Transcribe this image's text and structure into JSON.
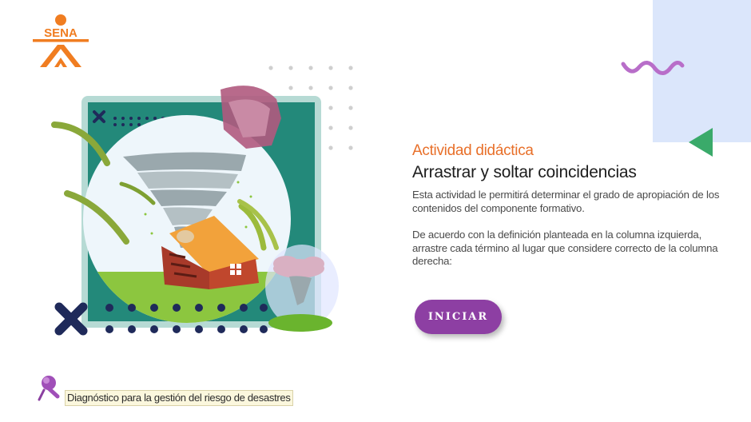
{
  "brand": {
    "logo_text": "SENA",
    "color": "#f07d21"
  },
  "content": {
    "subtitle": "Actividad didáctica",
    "title": "Arrastrar y soltar coincidencias",
    "paragraph1": "Esta actividad le permitirá determinar el grado de apropiación de los contenidos del componente formativo.",
    "paragraph2": "De acuerdo con la definición planteada en la columna izquierda, arrastre cada término al lugar que considere correcto de la columna derecha:"
  },
  "button": {
    "label": "INICIAR",
    "color": "#8d3fa3"
  },
  "footer": {
    "label": "Diagnóstico para la gestión del riesgo de desastres"
  },
  "colors": {
    "accent_orange": "#e8702a",
    "panel_blue": "#dbe6fb",
    "wave_purple": "#b86ec9",
    "triangle_green": "#3aaa6a",
    "navy": "#1f2a5a"
  },
  "icons": [
    "sena-logo",
    "tornado-illustration",
    "purple-wave-icon",
    "green-triangle-icon",
    "pushpin-icon"
  ]
}
